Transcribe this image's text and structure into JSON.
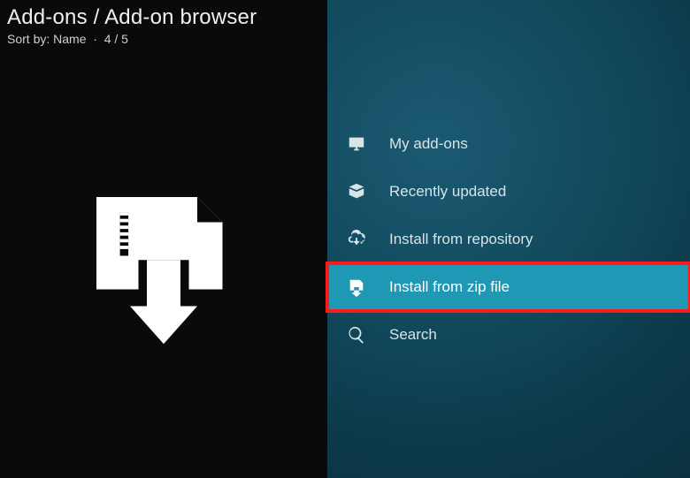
{
  "header": {
    "title": "Add-ons / Add-on browser",
    "sort_label": "Sort by: Name",
    "position": "4 / 5"
  },
  "preview": {
    "icon_name": "zip-file-download-icon"
  },
  "menu": {
    "items": [
      {
        "label": "My add-ons",
        "icon": "monitor-icon"
      },
      {
        "label": "Recently updated",
        "icon": "open-box-icon"
      },
      {
        "label": "Install from repository",
        "icon": "cloud-download-icon"
      },
      {
        "label": "Install from zip file",
        "icon": "zip-download-icon"
      },
      {
        "label": "Search",
        "icon": "search-icon"
      }
    ],
    "selected_index": 3,
    "highlighted_index": 3
  }
}
